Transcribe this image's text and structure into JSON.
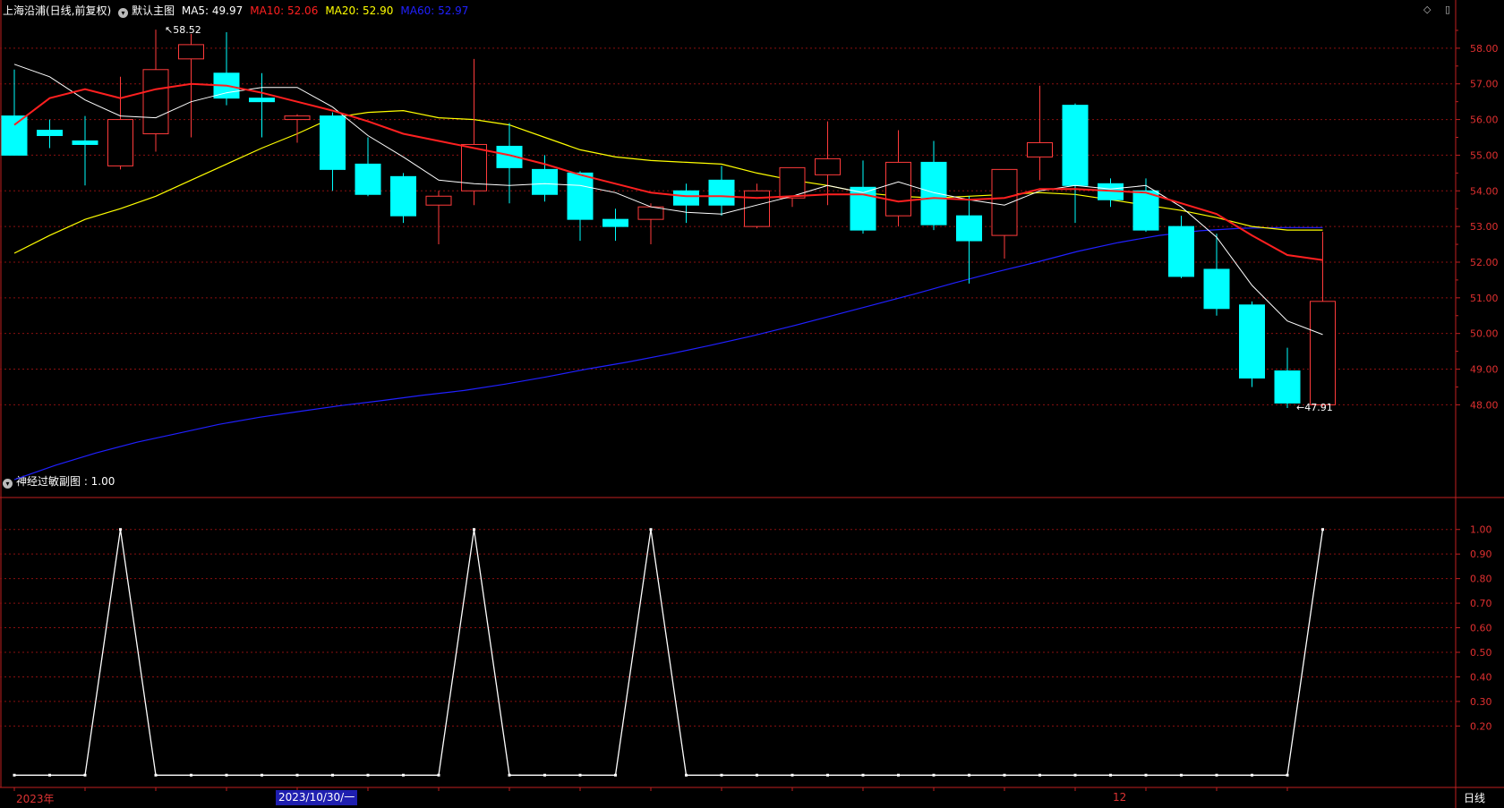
{
  "header": {
    "stock_name": "上海沿浦(日线,前复权)",
    "template_label": "默认主图",
    "ma_labels": [
      {
        "text": "MA5: 49.97",
        "color": "#ffffff"
      },
      {
        "text": "MA10: 52.06",
        "color": "#ff2020"
      },
      {
        "text": "MA20: 52.90",
        "color": "#ffff00"
      },
      {
        "text": "MA60: 52.97",
        "color": "#2020ff"
      }
    ]
  },
  "sub_header": {
    "label": "神经过敏副图 : 1.00"
  },
  "top_icons": {
    "diamond": "◇",
    "restore": "▯"
  },
  "colors": {
    "up": "#ff3b3b",
    "down": "#00ffff",
    "grid": "#8a1010",
    "axis": "#c02020",
    "ma5": "#ffffff",
    "ma10": "#ff2020",
    "ma20": "#ffff00",
    "ma60": "#2020ff"
  },
  "x_axis": {
    "year_label": "2023年",
    "cursor_date": "2023/10/30/一",
    "month_label": "12"
  },
  "period_label": "日线",
  "chart_data": [
    {
      "type": "candlestick",
      "title": "上海沿浦(日线,前复权)",
      "ylim": [
        45.4,
        58.85
      ],
      "yticks": [
        "48.00",
        "49.00",
        "50.00",
        "51.00",
        "52.00",
        "53.00",
        "54.00",
        "55.00",
        "56.00",
        "57.00",
        "58.00"
      ],
      "annotations": [
        {
          "text": "58.52",
          "bar": 4,
          "value": 58.52
        },
        {
          "text": "47.91",
          "bar": 36,
          "value": 47.91
        }
      ],
      "candles": [
        {
          "o": 56.1,
          "h": 57.4,
          "l": 55.8,
          "c": 55.0
        },
        {
          "o": 55.7,
          "h": 56.0,
          "l": 55.2,
          "c": 55.55
        },
        {
          "o": 55.4,
          "h": 56.1,
          "l": 54.15,
          "c": 55.3
        },
        {
          "o": 54.7,
          "h": 57.2,
          "l": 54.6,
          "c": 56.0
        },
        {
          "o": 55.6,
          "h": 58.52,
          "l": 55.1,
          "c": 57.4
        },
        {
          "o": 57.7,
          "h": 58.4,
          "l": 55.5,
          "c": 58.1
        },
        {
          "o": 57.3,
          "h": 58.45,
          "l": 56.4,
          "c": 56.6
        },
        {
          "o": 56.6,
          "h": 57.3,
          "l": 55.5,
          "c": 56.5
        },
        {
          "o": 56.0,
          "h": 56.15,
          "l": 55.35,
          "c": 56.1
        },
        {
          "o": 56.1,
          "h": 56.2,
          "l": 54.0,
          "c": 54.6
        },
        {
          "o": 54.75,
          "h": 55.5,
          "l": 53.85,
          "c": 53.9
        },
        {
          "o": 54.4,
          "h": 54.5,
          "l": 53.1,
          "c": 53.3
        },
        {
          "o": 53.6,
          "h": 54.0,
          "l": 52.5,
          "c": 53.85
        },
        {
          "o": 54.0,
          "h": 57.7,
          "l": 53.6,
          "c": 55.3
        },
        {
          "o": 55.25,
          "h": 55.9,
          "l": 53.65,
          "c": 54.65
        },
        {
          "o": 54.6,
          "h": 55.0,
          "l": 53.7,
          "c": 53.9
        },
        {
          "o": 54.5,
          "h": 54.55,
          "l": 52.6,
          "c": 53.2
        },
        {
          "o": 53.2,
          "h": 53.5,
          "l": 52.6,
          "c": 53.0
        },
        {
          "o": 53.2,
          "h": 53.65,
          "l": 52.5,
          "c": 53.55
        },
        {
          "o": 54.0,
          "h": 54.2,
          "l": 53.1,
          "c": 53.6
        },
        {
          "o": 54.3,
          "h": 54.7,
          "l": 53.3,
          "c": 53.6
        },
        {
          "o": 53.0,
          "h": 54.2,
          "l": 52.95,
          "c": 54.0
        },
        {
          "o": 53.8,
          "h": 54.6,
          "l": 53.55,
          "c": 54.65
        },
        {
          "o": 54.45,
          "h": 55.95,
          "l": 53.6,
          "c": 54.9
        },
        {
          "o": 54.1,
          "h": 54.85,
          "l": 52.8,
          "c": 52.9
        },
        {
          "o": 53.3,
          "h": 55.7,
          "l": 53.0,
          "c": 54.8
        },
        {
          "o": 54.8,
          "h": 55.4,
          "l": 52.9,
          "c": 53.05
        },
        {
          "o": 53.3,
          "h": 53.85,
          "l": 51.4,
          "c": 52.6
        },
        {
          "o": 52.75,
          "h": 54.4,
          "l": 52.1,
          "c": 54.6
        },
        {
          "o": 54.95,
          "h": 56.95,
          "l": 54.3,
          "c": 55.35
        },
        {
          "o": 56.4,
          "h": 56.45,
          "l": 53.1,
          "c": 54.15
        },
        {
          "o": 54.2,
          "h": 54.35,
          "l": 53.55,
          "c": 53.75
        },
        {
          "o": 54.0,
          "h": 54.35,
          "l": 52.85,
          "c": 52.9
        },
        {
          "o": 53.0,
          "h": 53.3,
          "l": 51.55,
          "c": 51.6
        },
        {
          "o": 51.8,
          "h": 52.8,
          "l": 50.5,
          "c": 50.7
        },
        {
          "o": 50.8,
          "h": 50.9,
          "l": 48.5,
          "c": 48.75
        },
        {
          "o": 48.95,
          "h": 49.6,
          "l": 47.91,
          "c": 48.05
        },
        {
          "o": 48.0,
          "h": 52.85,
          "l": 47.95,
          "c": 50.9
        }
      ],
      "ma5": [
        57.55,
        57.2,
        56.55,
        56.1,
        56.05,
        56.5,
        56.75,
        56.9,
        56.9,
        56.35,
        55.55,
        54.95,
        54.3,
        54.2,
        54.15,
        54.2,
        54.15,
        53.95,
        53.55,
        53.4,
        53.35,
        53.6,
        53.85,
        54.15,
        53.95,
        54.25,
        53.95,
        53.75,
        53.6,
        54.0,
        54.15,
        54.05,
        54.15,
        53.55,
        52.7,
        51.35,
        50.35,
        49.97
      ],
      "ma10": [
        55.85,
        56.6,
        56.85,
        56.6,
        56.85,
        57.0,
        56.95,
        56.75,
        56.5,
        56.25,
        55.95,
        55.6,
        55.4,
        55.2,
        55.0,
        54.75,
        54.45,
        54.2,
        53.95,
        53.85,
        53.85,
        53.8,
        53.85,
        53.9,
        53.9,
        53.7,
        53.8,
        53.75,
        53.8,
        54.05,
        54.05,
        54.0,
        53.95,
        53.65,
        53.35,
        52.75,
        52.2,
        52.06
      ],
      "ma20_start": 0,
      "ma20": [
        52.25,
        52.75,
        53.2,
        53.5,
        53.85,
        54.3,
        54.75,
        55.2,
        55.6,
        56.05,
        56.2,
        56.25,
        56.05,
        56.0,
        55.85,
        55.5,
        55.15,
        54.95,
        54.85,
        54.8,
        54.75,
        54.5,
        54.3,
        54.15,
        53.95,
        53.85,
        53.8,
        53.85,
        53.9,
        53.95,
        53.9,
        53.75,
        53.6,
        53.45,
        53.25,
        53.0,
        52.9,
        52.9
      ],
      "ma60": [
        45.9,
        46.3,
        46.65,
        46.95,
        47.2,
        47.45,
        47.65,
        47.82,
        47.98,
        48.12,
        48.27,
        48.4,
        48.58,
        48.78,
        49.0,
        49.2,
        49.42,
        49.66,
        49.92,
        50.2,
        50.5,
        50.8,
        51.1,
        51.42,
        51.72,
        52.0,
        52.3,
        52.55,
        52.75,
        52.88,
        52.95,
        52.97,
        52.97
      ]
    },
    {
      "type": "line",
      "title": "神经过敏副图",
      "ylim": [
        -0.05,
        1.05
      ],
      "yticks": [
        "0.20",
        "0.30",
        "0.40",
        "0.50",
        "0.60",
        "0.70",
        "0.80",
        "0.90",
        "1.00"
      ],
      "values": [
        0,
        0,
        0,
        1,
        0,
        0,
        0,
        0,
        0,
        0,
        0,
        0,
        0,
        1,
        0,
        0,
        0,
        0,
        1,
        0,
        0,
        0,
        0,
        0,
        0,
        0,
        0,
        0,
        0,
        0,
        0,
        0,
        0,
        0,
        0,
        0,
        0,
        1
      ]
    }
  ]
}
